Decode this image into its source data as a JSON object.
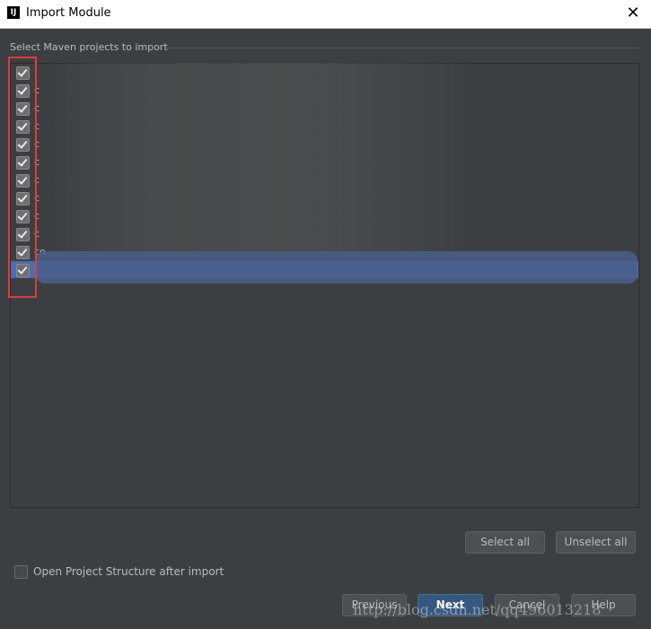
{
  "window": {
    "title": "Import Module",
    "close_glyph": "✕"
  },
  "section": {
    "label": "Select Maven projects to import"
  },
  "rows": [
    {
      "label": "",
      "checked": true
    },
    {
      "label": "c",
      "checked": true
    },
    {
      "label": "c",
      "checked": true
    },
    {
      "label": "c",
      "checked": true
    },
    {
      "label": "c",
      "checked": true
    },
    {
      "label": "c",
      "checked": true
    },
    {
      "label": "c",
      "checked": true
    },
    {
      "label": "c",
      "checked": true
    },
    {
      "label": "c",
      "checked": true
    },
    {
      "label": "c",
      "checked": true
    },
    {
      "label": "co",
      "checked": true
    },
    {
      "label": "",
      "checked": true,
      "selected": true
    }
  ],
  "buttons": {
    "select_all": "Select all",
    "unselect_all": "Unselect all",
    "previous": "Previous",
    "next": "Next",
    "cancel": "Cancel",
    "help": "Help"
  },
  "options": {
    "open_structure": "Open Project Structure after import"
  },
  "watermark": "http://blog.csdn.net/qq496013218",
  "colors": {
    "background": "#3c3f41",
    "selection": "#4b6eaf",
    "annotation": "#e03c3c",
    "default_button": "#365880"
  },
  "icons": {
    "app": "intellij-icon",
    "checkbox": "checkmark-icon"
  }
}
